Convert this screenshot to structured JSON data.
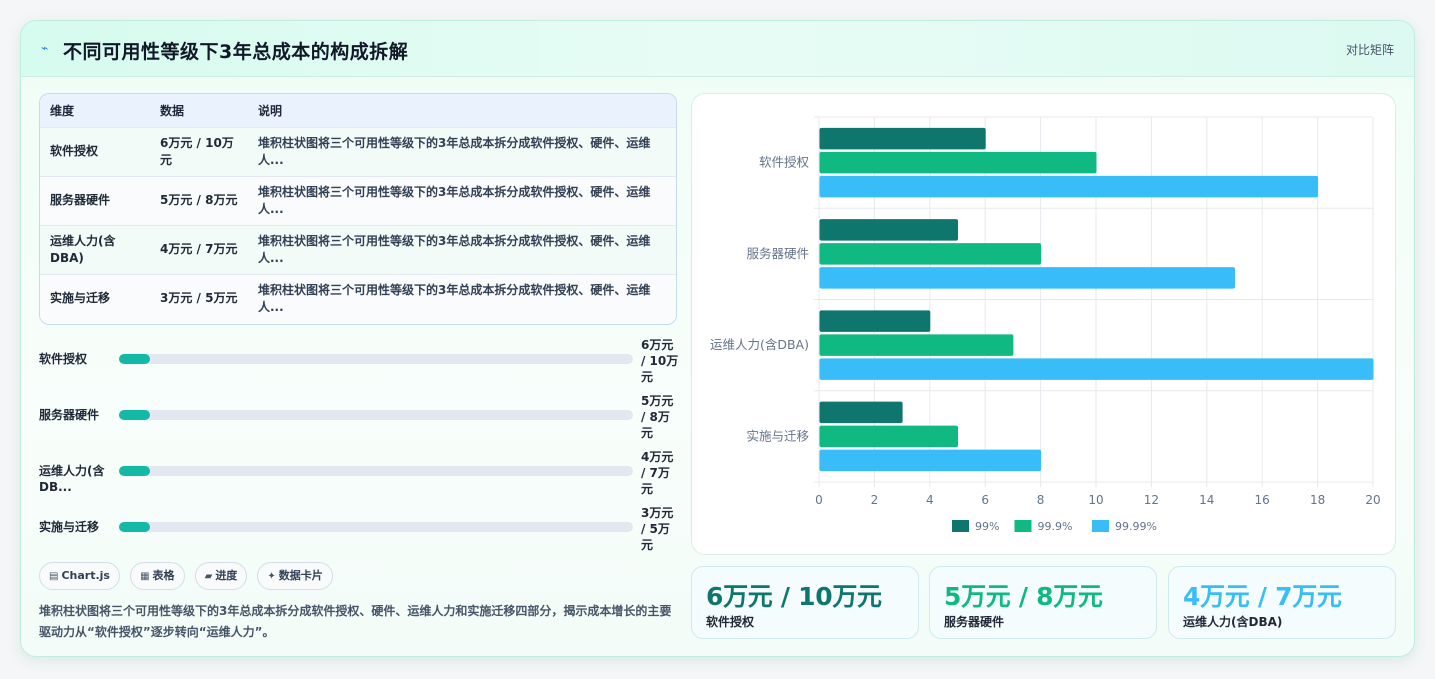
{
  "header": {
    "title": "不同可用性等级下3年总成本的构成拆解",
    "action": "对比矩阵"
  },
  "table": {
    "columns": [
      "维度",
      "数据",
      "说明"
    ],
    "rows": [
      {
        "dim": "软件授权",
        "data": "6万元 / 10万元",
        "desc": "堆积柱状图将三个可用性等级下的3年总成本拆分成软件授权、硬件、运维人..."
      },
      {
        "dim": "服务器硬件",
        "data": "5万元 / 8万元",
        "desc": "堆积柱状图将三个可用性等级下的3年总成本拆分成软件授权、硬件、运维人..."
      },
      {
        "dim": "运维人力(含DBA)",
        "data": "4万元 / 7万元",
        "desc": "堆积柱状图将三个可用性等级下的3年总成本拆分成软件授权、硬件、运维人..."
      },
      {
        "dim": "实施与迁移",
        "data": "3万元 / 5万元",
        "desc": "堆积柱状图将三个可用性等级下的3年总成本拆分成软件授权、硬件、运维人..."
      }
    ]
  },
  "progress": [
    {
      "label": "软件授权",
      "value": "6万元 / 10万元",
      "fraction": 0.06
    },
    {
      "label": "服务器硬件",
      "value": "5万元 / 8万元",
      "fraction": 0.06
    },
    {
      "label": "运维人力(含DB...",
      "value": "4万元 / 7万元",
      "fraction": 0.06
    },
    {
      "label": "实施与迁移",
      "value": "3万元 / 5万元",
      "fraction": 0.06
    }
  ],
  "chips": [
    {
      "icon": "▤",
      "label": "Chart.js"
    },
    {
      "icon": "▦",
      "label": "表格"
    },
    {
      "icon": "▰",
      "label": "进度"
    },
    {
      "icon": "✦",
      "label": "数据卡片"
    }
  ],
  "summary": "堆积柱状图将三个可用性等级下的3年总成本拆分成软件授权、硬件、运维人力和实施迁移四部分，揭示成本增长的主要驱动力从“软件授权”逐步转向“运维人力”。",
  "kpis": [
    {
      "value": "6万元 / 10万元",
      "label": "软件授权",
      "color": "#0f766e"
    },
    {
      "value": "5万元 / 8万元",
      "label": "服务器硬件",
      "color": "#10b981"
    },
    {
      "value": "4万元 / 7万元",
      "label": "运维人力(含DBA)",
      "color": "#38bdf8"
    }
  ],
  "chart_data": {
    "type": "bar",
    "orientation": "horizontal",
    "categories": [
      "软件授权",
      "服务器硬件",
      "运维人力(含DBA)",
      "实施与迁移"
    ],
    "series": [
      {
        "name": "99%",
        "values": [
          6,
          5,
          4,
          3
        ],
        "color": "#0f766e"
      },
      {
        "name": "99.9%",
        "values": [
          10,
          8,
          7,
          5
        ],
        "color": "#10b981"
      },
      {
        "name": "99.99%",
        "values": [
          18,
          15,
          20,
          8
        ],
        "color": "#38bdf8"
      }
    ],
    "xlim": [
      0,
      20
    ],
    "xticks": [
      "0",
      "2",
      "4",
      "6",
      "8",
      "10",
      "12",
      "14",
      "16",
      "18",
      "20"
    ],
    "grid": true,
    "legend": "bottom"
  }
}
